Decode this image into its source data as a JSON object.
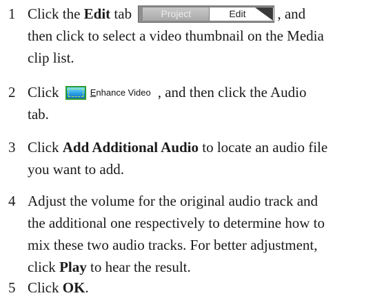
{
  "tabs": {
    "project": "Project",
    "edit": "Edit"
  },
  "enhance_button": {
    "label_first": "E",
    "label_rest": "nhance Video"
  },
  "steps": [
    {
      "num": "1",
      "l1_a": "Click the ",
      "l1_b": "Edit",
      "l1_c": " tab",
      "l1_d": ", and",
      "l2": "then click to select a video thumbnail on the Media",
      "l3": "clip list."
    },
    {
      "num": "2",
      "l1_a": "Click",
      "l1_d": ", and then click the Audio",
      "l2": "tab."
    },
    {
      "num": "3",
      "l1_a": "Click ",
      "l1_b": "Add Additional Audio",
      "l1_c": " to locate an audio file",
      "l2": "you want to add."
    },
    {
      "num": "4",
      "l1": "Adjust the volume for the original audio track and",
      "l2": "the additional one respectively to determine how to",
      "l3": "mix these two audio tracks. For better adjustment,",
      "l4_a": "click ",
      "l4_b": "Play",
      "l4_c": " to hear the result."
    },
    {
      "num": "5",
      "l1_a": "Click ",
      "l1_b": "OK",
      "l1_c": "."
    }
  ]
}
